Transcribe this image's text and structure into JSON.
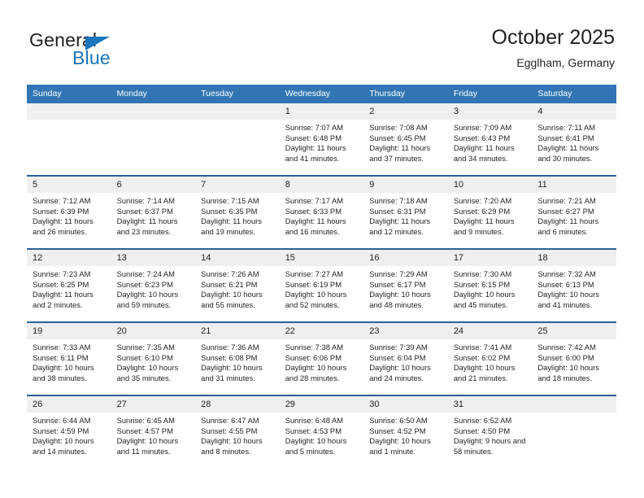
{
  "brand": {
    "name_top": "General",
    "name_bottom": "Blue",
    "accent_color": "#1b75bc"
  },
  "header": {
    "title": "October 2025",
    "subtitle": "Egglham, Germany"
  },
  "theme": {
    "header_row_bg": "#3175b4",
    "row_divider": "#2a6099",
    "daynum_bg": "#efefef",
    "text": "#231f20"
  },
  "weekday_headers": [
    "Sunday",
    "Monday",
    "Tuesday",
    "Wednesday",
    "Thursday",
    "Friday",
    "Saturday"
  ],
  "weeks": [
    [
      {
        "day": "",
        "blank": true,
        "sunrise": "",
        "sunset": "",
        "daylight": ""
      },
      {
        "day": "",
        "blank": true,
        "sunrise": "",
        "sunset": "",
        "daylight": ""
      },
      {
        "day": "",
        "blank": true,
        "sunrise": "",
        "sunset": "",
        "daylight": ""
      },
      {
        "day": "1",
        "blank": false,
        "sunrise": "Sunrise: 7:07 AM",
        "sunset": "Sunset: 6:48 PM",
        "daylight": "Daylight: 11 hours and 41 minutes."
      },
      {
        "day": "2",
        "blank": false,
        "sunrise": "Sunrise: 7:08 AM",
        "sunset": "Sunset: 6:45 PM",
        "daylight": "Daylight: 11 hours and 37 minutes."
      },
      {
        "day": "3",
        "blank": false,
        "sunrise": "Sunrise: 7:09 AM",
        "sunset": "Sunset: 6:43 PM",
        "daylight": "Daylight: 11 hours and 34 minutes."
      },
      {
        "day": "4",
        "blank": false,
        "sunrise": "Sunrise: 7:11 AM",
        "sunset": "Sunset: 6:41 PM",
        "daylight": "Daylight: 11 hours and 30 minutes."
      }
    ],
    [
      {
        "day": "5",
        "blank": false,
        "sunrise": "Sunrise: 7:12 AM",
        "sunset": "Sunset: 6:39 PM",
        "daylight": "Daylight: 11 hours and 26 minutes."
      },
      {
        "day": "6",
        "blank": false,
        "sunrise": "Sunrise: 7:14 AM",
        "sunset": "Sunset: 6:37 PM",
        "daylight": "Daylight: 11 hours and 23 minutes."
      },
      {
        "day": "7",
        "blank": false,
        "sunrise": "Sunrise: 7:15 AM",
        "sunset": "Sunset: 6:35 PM",
        "daylight": "Daylight: 11 hours and 19 minutes."
      },
      {
        "day": "8",
        "blank": false,
        "sunrise": "Sunrise: 7:17 AM",
        "sunset": "Sunset: 6:33 PM",
        "daylight": "Daylight: 11 hours and 16 minutes."
      },
      {
        "day": "9",
        "blank": false,
        "sunrise": "Sunrise: 7:18 AM",
        "sunset": "Sunset: 6:31 PM",
        "daylight": "Daylight: 11 hours and 12 minutes."
      },
      {
        "day": "10",
        "blank": false,
        "sunrise": "Sunrise: 7:20 AM",
        "sunset": "Sunset: 6:29 PM",
        "daylight": "Daylight: 11 hours and 9 minutes."
      },
      {
        "day": "11",
        "blank": false,
        "sunrise": "Sunrise: 7:21 AM",
        "sunset": "Sunset: 6:27 PM",
        "daylight": "Daylight: 11 hours and 6 minutes."
      }
    ],
    [
      {
        "day": "12",
        "blank": false,
        "sunrise": "Sunrise: 7:23 AM",
        "sunset": "Sunset: 6:25 PM",
        "daylight": "Daylight: 11 hours and 2 minutes."
      },
      {
        "day": "13",
        "blank": false,
        "sunrise": "Sunrise: 7:24 AM",
        "sunset": "Sunset: 6:23 PM",
        "daylight": "Daylight: 10 hours and 59 minutes."
      },
      {
        "day": "14",
        "blank": false,
        "sunrise": "Sunrise: 7:26 AM",
        "sunset": "Sunset: 6:21 PM",
        "daylight": "Daylight: 10 hours and 55 minutes."
      },
      {
        "day": "15",
        "blank": false,
        "sunrise": "Sunrise: 7:27 AM",
        "sunset": "Sunset: 6:19 PM",
        "daylight": "Daylight: 10 hours and 52 minutes."
      },
      {
        "day": "16",
        "blank": false,
        "sunrise": "Sunrise: 7:29 AM",
        "sunset": "Sunset: 6:17 PM",
        "daylight": "Daylight: 10 hours and 48 minutes."
      },
      {
        "day": "17",
        "blank": false,
        "sunrise": "Sunrise: 7:30 AM",
        "sunset": "Sunset: 6:15 PM",
        "daylight": "Daylight: 10 hours and 45 minutes."
      },
      {
        "day": "18",
        "blank": false,
        "sunrise": "Sunrise: 7:32 AM",
        "sunset": "Sunset: 6:13 PM",
        "daylight": "Daylight: 10 hours and 41 minutes."
      }
    ],
    [
      {
        "day": "19",
        "blank": false,
        "sunrise": "Sunrise: 7:33 AM",
        "sunset": "Sunset: 6:11 PM",
        "daylight": "Daylight: 10 hours and 38 minutes."
      },
      {
        "day": "20",
        "blank": false,
        "sunrise": "Sunrise: 7:35 AM",
        "sunset": "Sunset: 6:10 PM",
        "daylight": "Daylight: 10 hours and 35 minutes."
      },
      {
        "day": "21",
        "blank": false,
        "sunrise": "Sunrise: 7:36 AM",
        "sunset": "Sunset: 6:08 PM",
        "daylight": "Daylight: 10 hours and 31 minutes."
      },
      {
        "day": "22",
        "blank": false,
        "sunrise": "Sunrise: 7:38 AM",
        "sunset": "Sunset: 6:06 PM",
        "daylight": "Daylight: 10 hours and 28 minutes."
      },
      {
        "day": "23",
        "blank": false,
        "sunrise": "Sunrise: 7:39 AM",
        "sunset": "Sunset: 6:04 PM",
        "daylight": "Daylight: 10 hours and 24 minutes."
      },
      {
        "day": "24",
        "blank": false,
        "sunrise": "Sunrise: 7:41 AM",
        "sunset": "Sunset: 6:02 PM",
        "daylight": "Daylight: 10 hours and 21 minutes."
      },
      {
        "day": "25",
        "blank": false,
        "sunrise": "Sunrise: 7:42 AM",
        "sunset": "Sunset: 6:00 PM",
        "daylight": "Daylight: 10 hours and 18 minutes."
      }
    ],
    [
      {
        "day": "26",
        "blank": false,
        "sunrise": "Sunrise: 6:44 AM",
        "sunset": "Sunset: 4:59 PM",
        "daylight": "Daylight: 10 hours and 14 minutes."
      },
      {
        "day": "27",
        "blank": false,
        "sunrise": "Sunrise: 6:45 AM",
        "sunset": "Sunset: 4:57 PM",
        "daylight": "Daylight: 10 hours and 11 minutes."
      },
      {
        "day": "28",
        "blank": false,
        "sunrise": "Sunrise: 6:47 AM",
        "sunset": "Sunset: 4:55 PM",
        "daylight": "Daylight: 10 hours and 8 minutes."
      },
      {
        "day": "29",
        "blank": false,
        "sunrise": "Sunrise: 6:48 AM",
        "sunset": "Sunset: 4:53 PM",
        "daylight": "Daylight: 10 hours and 5 minutes."
      },
      {
        "day": "30",
        "blank": false,
        "sunrise": "Sunrise: 6:50 AM",
        "sunset": "Sunset: 4:52 PM",
        "daylight": "Daylight: 10 hours and 1 minute."
      },
      {
        "day": "31",
        "blank": false,
        "sunrise": "Sunrise: 6:52 AM",
        "sunset": "Sunset: 4:50 PM",
        "daylight": "Daylight: 9 hours and 58 minutes."
      },
      {
        "day": "",
        "blank": true,
        "sunrise": "",
        "sunset": "",
        "daylight": ""
      }
    ]
  ]
}
